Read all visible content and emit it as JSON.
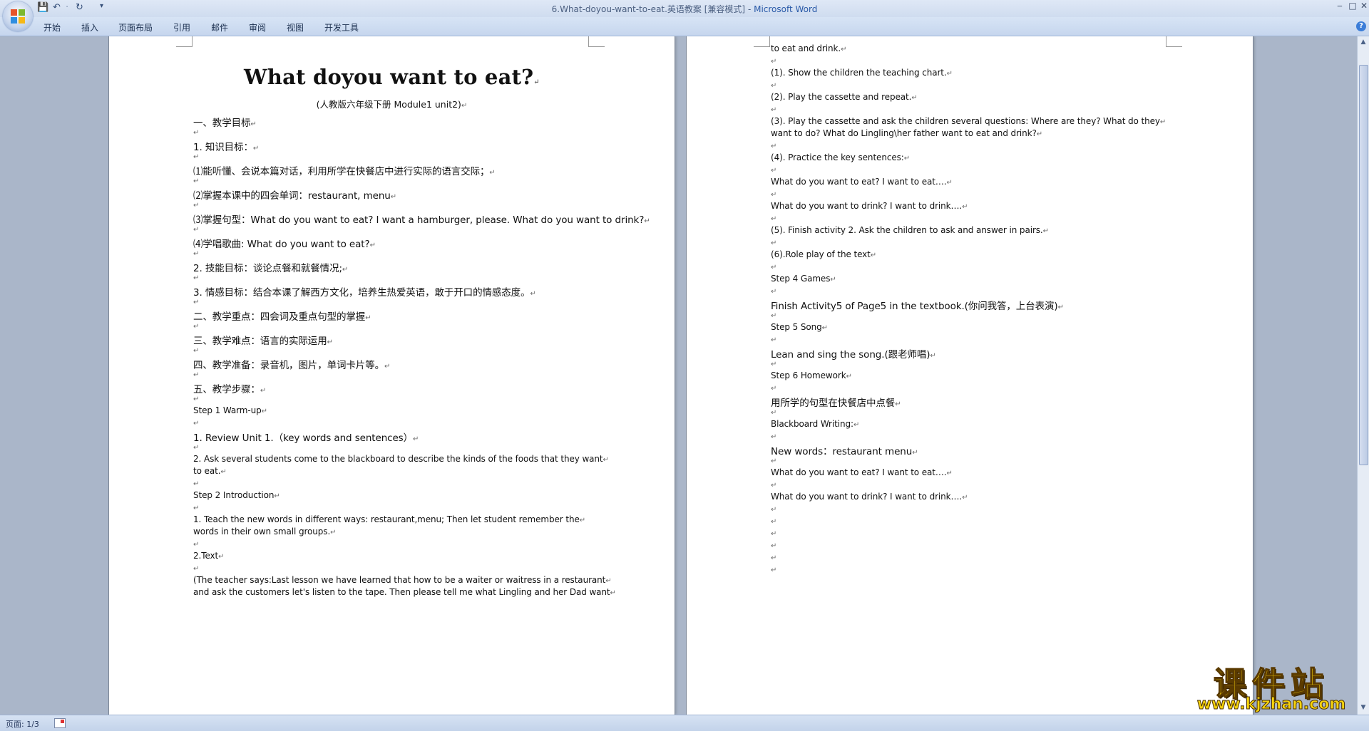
{
  "window": {
    "title": "6.What-doyou-want-to-eat.英语教案 [兼容模式]",
    "title_sep": " - ",
    "app_name": "Microsoft Word",
    "min_symbol": "‒",
    "max_symbol": "□",
    "close_symbol": "✕"
  },
  "qat": {
    "save": "💾",
    "undo": "↶",
    "redo": "↻",
    "dropdown": "▾",
    "undo_sep": "·"
  },
  "ribbon": {
    "tabs": [
      "开始",
      "插入",
      "页面布局",
      "引用",
      "邮件",
      "审阅",
      "视图",
      "开发工具"
    ],
    "help": "?"
  },
  "page1": {
    "title": "What doyou want to eat?",
    "subtitle": "(人教版六年级下册 Module1 unit2)",
    "lines": [
      "一、教学目标",
      "",
      "1. 知识目标：",
      "",
      "⑴能听懂、会说本篇对话，利用所学在快餐店中进行实际的语言交际；",
      "",
      "⑵掌握本课中的四会单词：restaurant, menu",
      "",
      "⑶掌握句型：What do you want to eat? I want a hamburger, please. What do you want to drink?",
      "",
      "⑷学唱歌曲: What do you want to eat?",
      "",
      "2. 技能目标：谈论点餐和就餐情况;",
      "",
      "3. 情感目标：结合本课了解西方文化，培养生热爱英语，敢于开口的情感态度。",
      "",
      "二、教学重点：四会词及重点句型的掌握",
      "",
      "三、教学难点：语言的实际运用",
      "",
      "四、教学准备：录音机，图片，单词卡片等。",
      "",
      "五、教学步骤：",
      "",
      "Step 1 Warm-up",
      "",
      "1. Review Unit 1.（key words and sentences）",
      "",
      "2. Ask several students come to the blackboard to describe the kinds of the foods that they want",
      "to eat.",
      "",
      "Step 2 Introduction",
      "",
      "1.    Teach the new words in different ways: restaurant,menu; Then let student remember the",
      "       words in their own small groups.",
      "",
      "2.Text",
      "",
      "(The teacher says:Last lesson we have learned that how to be a waiter or waitress in a restaurant",
      "and ask the customers let's listen to the tape. Then please tell me what Lingling and her Dad want"
    ]
  },
  "page2": {
    "lines": [
      "to eat and drink.",
      "",
      "(1). Show the children the teaching chart.",
      "",
      "(2). Play the cassette and repeat.",
      "",
      "(3). Play the cassette and ask the children several questions: Where are they?      What do they",
      "want to do? What do Lingling\\her father want to eat and drink?",
      "",
      "(4). Practice the key sentences:",
      "",
      "What do you want to eat?          I want to eat….",
      "",
      "What do you want to drink?       I want to drink….",
      "",
      "(5). Finish activity 2. Ask the children to ask and answer in pairs.",
      "",
      "(6).Role play of the text",
      "",
      "Step 4 Games",
      "",
      " Finish Activity5 of Page5 in the textbook.(你问我答，上台表演)",
      "",
      "Step 5 Song",
      "",
      "Lean and sing the song.(跟老师唱)",
      "",
      "Step 6 Homework",
      "",
      "用所学的句型在快餐店中点餐",
      "",
      " Blackboard Writing:",
      "",
      " New words：restaurant       menu",
      "",
      "What do you want to eat?          I want to eat….",
      "",
      "What do you want to drink?       I want to drink….",
      "",
      "",
      "",
      "",
      "",
      ""
    ]
  },
  "paragraph_mark": "↵",
  "scrollbar": {
    "up": "▲",
    "down": "▼"
  },
  "status": {
    "page_indicator": "页面: 1/3"
  },
  "watermark": {
    "text": "课件站",
    "url": "www.kjzhan.com"
  },
  "colors": {
    "ribbon_bg": "#c6d6ee",
    "workspace_bg": "#aab6c9",
    "title_app": "#2a5aa8",
    "watermark": "#f6d30c"
  }
}
